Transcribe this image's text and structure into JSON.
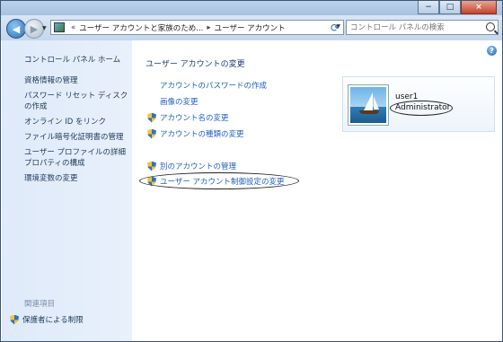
{
  "window": {
    "caption_buttons": [
      "−",
      "□",
      "×"
    ]
  },
  "address_bar": {
    "overflow": "«",
    "crumbs": [
      "ユーザー アカウントと家族のため...",
      "ユーザー アカウント"
    ],
    "separator": "▸",
    "search_placeholder": "コントロール パネルの検索"
  },
  "sidebar": {
    "home": "コントロール パネル ホーム",
    "items": [
      "資格情報の管理",
      "パスワード リセット ディスクの作成",
      "オンライン ID をリンク",
      "ファイル暗号化証明書の管理",
      "ユーザー プロファイルの詳細プロパティの構成",
      "環境変数の変更"
    ],
    "related_heading": "関連項目",
    "related_item": "保護者による制限"
  },
  "main": {
    "help": "?",
    "title": "ユーザー アカウントの変更",
    "tasks": [
      {
        "label": "アカウントのパスワードの作成",
        "shield": false
      },
      {
        "label": "画像の変更",
        "shield": false
      },
      {
        "label": "アカウント名の変更",
        "shield": true
      },
      {
        "label": "アカウントの種類の変更",
        "shield": true
      }
    ],
    "other_tasks": [
      {
        "label": "別のアカウントの管理",
        "shield": true
      },
      {
        "label": "ユーザー アカウント制御設定の変更",
        "shield": true
      }
    ],
    "user": {
      "name": "user1",
      "role": "Administrator"
    }
  },
  "colors": {
    "link": "#1f5fbf",
    "sidebar_bg": "#dfeafa",
    "title": "#1e3d74"
  }
}
